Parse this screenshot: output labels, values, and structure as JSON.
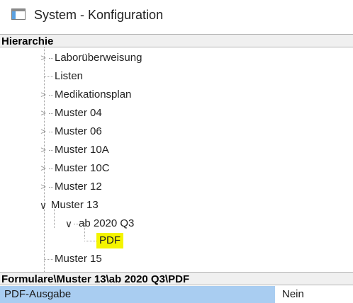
{
  "window": {
    "title": "System - Konfiguration",
    "icon": "window-app-icon"
  },
  "hierarchy": {
    "header": "Hierarchie",
    "items": [
      {
        "label": "Laborüberweisung",
        "expander": "collapsed",
        "level": 1
      },
      {
        "label": "Listen",
        "expander": "none",
        "level": 1
      },
      {
        "label": "Medikationsplan",
        "expander": "collapsed",
        "level": 1
      },
      {
        "label": "Muster 04",
        "expander": "collapsed",
        "level": 1
      },
      {
        "label": "Muster 06",
        "expander": "collapsed",
        "level": 1
      },
      {
        "label": "Muster 10A",
        "expander": "collapsed",
        "level": 1
      },
      {
        "label": "Muster 10C",
        "expander": "collapsed",
        "level": 1
      },
      {
        "label": "Muster 12",
        "expander": "collapsed",
        "level": 1
      },
      {
        "label": "Muster 13",
        "expander": "expanded",
        "level": 1
      },
      {
        "label": "ab 2020 Q3",
        "expander": "expanded",
        "level": 2
      },
      {
        "label": "PDF",
        "expander": "none",
        "level": 3,
        "selected": true
      },
      {
        "label": "Muster 15",
        "expander": "none",
        "level": 1
      }
    ],
    "highlight_color": "#f4f400"
  },
  "path": {
    "header": "Formulare\\Muster 13\\ab 2020 Q3\\PDF"
  },
  "properties": [
    {
      "name": "PDF-Ausgabe",
      "value": "Nein",
      "selected": true,
      "selected_color": "#a9cdf1"
    }
  ]
}
